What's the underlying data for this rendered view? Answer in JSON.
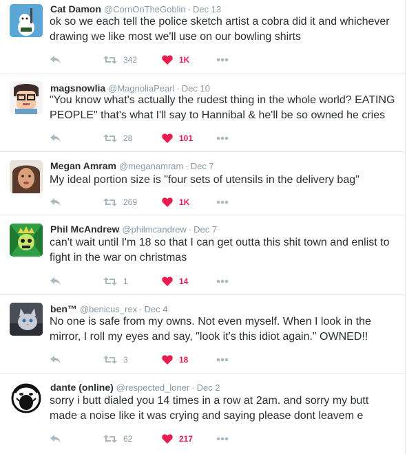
{
  "tweets": [
    {
      "fullname": "Cat Damon",
      "username": "@CornOnTheGoblin",
      "separator": "·",
      "time": "Dec 13",
      "text": "ok so we each tell the police sketch artist a cobra did it and whichever drawing we like most we'll use on our bowling shirts",
      "retweets": "342",
      "likes": "1K",
      "avatar_colors": [
        "#5aa6d6",
        "#ffffff"
      ]
    },
    {
      "fullname": "magsnowlia",
      "username": "@MagnoliaPearl",
      "separator": "·",
      "time": "Dec 10",
      "text": "\"You know what's actually the rudest thing in the whole world? EATING PEOPLE\" that's what I'll say to Hannibal & he'll be so owned he cries",
      "retweets": "28",
      "likes": "101",
      "avatar_colors": [
        "#f4c9a5",
        "#3a2a2a"
      ]
    },
    {
      "fullname": "Megan Amram",
      "username": "@meganamram",
      "separator": "·",
      "time": "Dec 7",
      "text": "My ideal portion size is \"four sets of utensils in the delivery bag\"",
      "retweets": "269",
      "likes": "1K",
      "avatar_colors": [
        "#c98a6a",
        "#5a3a2a"
      ]
    },
    {
      "fullname": "Phil McAndrew",
      "username": "@philmcandrew",
      "separator": "·",
      "time": "Dec 7",
      "text": "can't wait until I'm 18 so that I can get outta this shit town and enlist to fight in the war on christmas",
      "retweets": "1",
      "likes": "14",
      "avatar_colors": [
        "#2f9e44",
        "#c8e86a"
      ]
    },
    {
      "fullname": "ben™",
      "username": "@benicus_rex",
      "separator": "·",
      "time": "Dec 4",
      "text": "No one is safe from my owns. Not even myself. When I look in the mirror, I roll my eyes and say, \"look it's this idiot again.\" OWNED!!",
      "retweets": "3",
      "likes": "18",
      "avatar_colors": [
        "#6b6f7a",
        "#c8ccd6"
      ]
    },
    {
      "fullname": "dante (online)",
      "username": "@respected_loner",
      "separator": "·",
      "time": "Dec 2",
      "text": "sorry i butt dialed you 14 times in a row at 2am. and sorry my butt made a noise like it was crying and saying please dont leavem e",
      "retweets": "62",
      "likes": "217",
      "avatar_colors": [
        "#ffffff",
        "#111111"
      ]
    }
  ],
  "icons": {
    "reply": "reply-icon",
    "retweet": "retweet-icon",
    "like": "heart-icon",
    "more": "more-icon"
  },
  "colors": {
    "action_gray": "#aab8c2",
    "like_red": "#e81c4f",
    "meta_gray": "#8899a6",
    "text": "#292f33",
    "divider": "#e1e8ed"
  }
}
